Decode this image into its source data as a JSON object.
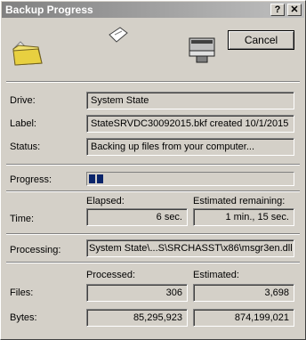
{
  "window": {
    "title": "Backup Progress",
    "help_glyph": "?",
    "close_glyph": "✕"
  },
  "buttons": {
    "cancel": "Cancel"
  },
  "fields": {
    "drive": {
      "label": "Drive:",
      "value": "System State"
    },
    "label": {
      "label": "Label:",
      "value": "StateSRVDC30092015.bkf created 10/1/2015"
    },
    "status": {
      "label": "Status:",
      "value": "Backing up files from your computer..."
    }
  },
  "progress": {
    "label": "Progress:",
    "value": 0.09,
    "blocks": 2
  },
  "time": {
    "label": "Time:",
    "elapsed_label": "Elapsed:",
    "elapsed": "6 sec.",
    "remaining_label": "Estimated remaining:",
    "remaining": "1 min., 15 sec."
  },
  "processing": {
    "label": "Processing:",
    "value": "System State\\...S\\SRCHASST\\x86\\msgr3en.dll"
  },
  "counts": {
    "processed_label": "Processed:",
    "estimated_label": "Estimated:",
    "files_label": "Files:",
    "bytes_label": "Bytes:",
    "files_processed": "306",
    "files_estimated": "3,698",
    "bytes_processed": "85,295,923",
    "bytes_estimated": "874,199,021"
  },
  "icons": {
    "source": "folder-icon",
    "flying": "flying-document-icon",
    "target": "computer-tape-drive-icon"
  }
}
